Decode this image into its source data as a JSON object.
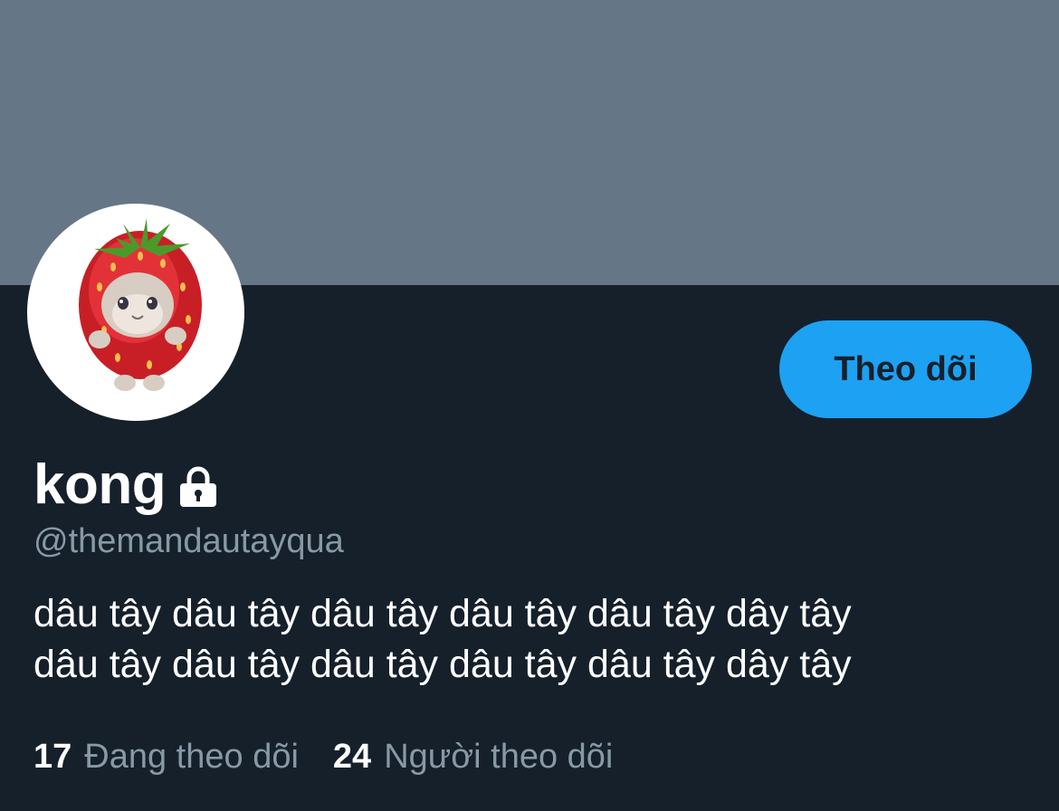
{
  "profile": {
    "display_name": "kong",
    "handle": "@themandautayqua",
    "protected_icon": "lock-icon",
    "avatar_icon": "strawberry-cat-avatar",
    "bio_lines": [
      "dâu tây dâu tây dâu tây dâu tây dâu tây dây tây",
      "dâu tây dâu tây dâu tây dâu tây dâu tây dây tây"
    ],
    "follow_label": "Theo dõi",
    "following_count": "17",
    "following_label": "Đang theo dõi",
    "followers_count": "24",
    "followers_label": "Người theo dõi"
  },
  "colors": {
    "banner": "#657786",
    "background": "#15202b",
    "accent": "#1da1f2",
    "secondary_text": "#8899a6",
    "primary_text": "#ffffff"
  }
}
